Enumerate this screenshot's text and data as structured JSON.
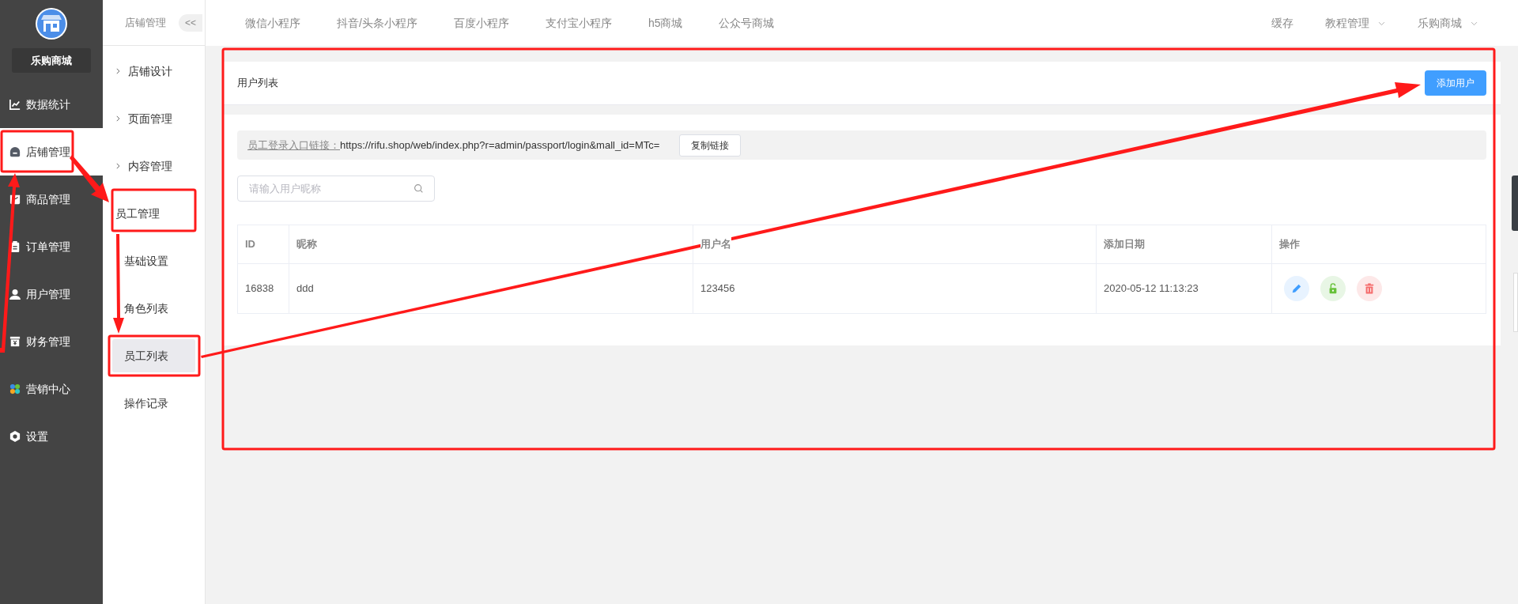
{
  "sidebar": {
    "store_name": "乐购商城",
    "items": [
      {
        "label": "数据统计",
        "selected": false
      },
      {
        "label": "店铺管理",
        "selected": true
      },
      {
        "label": "商品管理",
        "selected": false
      },
      {
        "label": "订单管理",
        "selected": false
      },
      {
        "label": "用户管理",
        "selected": false
      },
      {
        "label": "财务管理",
        "selected": false
      },
      {
        "label": "营销中心",
        "selected": false
      },
      {
        "label": "设置",
        "selected": false
      }
    ]
  },
  "submenu": {
    "title": "店铺管理",
    "collapse_button": "<<",
    "items": [
      {
        "label": "店铺设计",
        "expanded": false
      },
      {
        "label": "页面管理",
        "expanded": false
      },
      {
        "label": "内容管理",
        "expanded": false
      },
      {
        "label": "员工管理",
        "expanded": true,
        "children": [
          {
            "label": "基础设置",
            "selected": false
          },
          {
            "label": "角色列表",
            "selected": false
          },
          {
            "label": "员工列表",
            "selected": true
          },
          {
            "label": "操作记录",
            "selected": false
          }
        ]
      }
    ]
  },
  "top_nav": {
    "tabs": [
      "微信小程序",
      "抖音/头条小程序",
      "百度小程序",
      "支付宝小程序",
      "h5商城",
      "公众号商城"
    ],
    "right": [
      {
        "label": "缓存",
        "dropdown": false
      },
      {
        "label": "教程管理",
        "dropdown": true
      },
      {
        "label": "乐购商城",
        "dropdown": true
      }
    ]
  },
  "card": {
    "title": "用户列表",
    "add_button": "添加用户",
    "login_link": {
      "label": "员工登录入口链接：",
      "url": "https://rifu.shop/web/index.php?r=admin/passport/login&mall_id=MTc=",
      "copy_button": "复制链接"
    },
    "search": {
      "placeholder": "请输入用户昵称"
    },
    "table": {
      "columns": [
        "ID",
        "昵称",
        "用户名",
        "添加日期",
        "操作"
      ],
      "rows": [
        {
          "cells": [
            "16838",
            "ddd",
            "123456",
            "2020-05-12 11:13:23"
          ],
          "actions": [
            {
              "kind": "edit"
            },
            {
              "kind": "unlock"
            },
            {
              "kind": "delete"
            }
          ]
        }
      ]
    }
  }
}
